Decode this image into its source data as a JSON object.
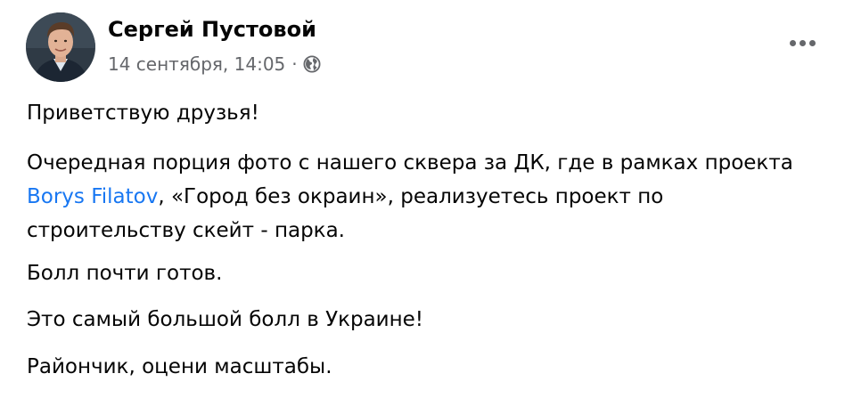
{
  "post": {
    "author": {
      "name": "Сергей Пустовой"
    },
    "timestamp": "14 сентября, 14:05",
    "separator": "·",
    "privacy_icon": "globe-icon",
    "more_icon": "more-horizontal-icon",
    "body": {
      "p1": "Приветствую друзья!",
      "p2_before": "Очередная порция фото с нашего сквера за ДК, где в рамках проекта ",
      "p2_mention": "Borys Filatov",
      "p2_after": ", «Город без окраин», реализуетесь проект по строительству скейт - парка.",
      "p3": "Болл почти готов.",
      "p4": "Это самый большой болл в Украине!",
      "p5": "Райончик, оцени масштабы."
    }
  },
  "colors": {
    "text": "#050505",
    "secondary": "#65676b",
    "link": "#1877f2"
  }
}
